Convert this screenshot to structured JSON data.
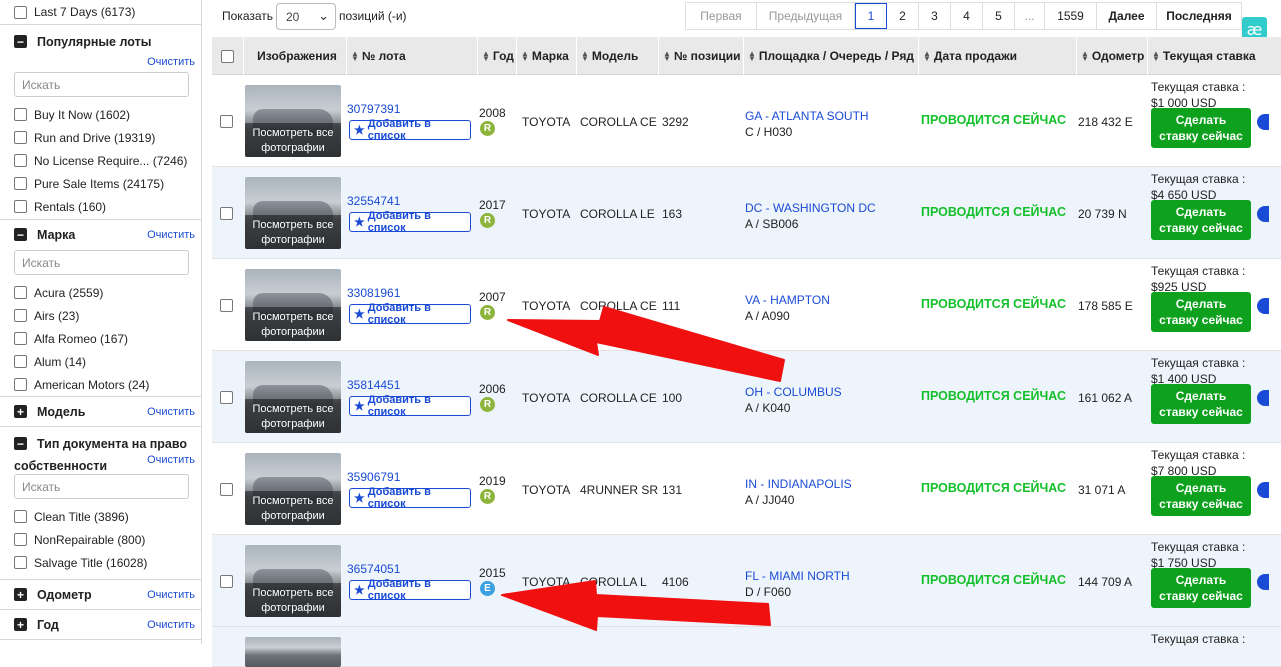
{
  "sidebar": {
    "top_item": {
      "label": "Last 7 Days (6173)"
    },
    "sections": {
      "popular": {
        "title": "Популярные лоты",
        "clear": "Очистить",
        "search_placeholder": "Искать",
        "items": [
          "Buy It Now (1602)",
          "Run and Drive (19319)",
          "No License Require... (7246)",
          "Pure Sale Items (24175)",
          "Rentals (160)"
        ]
      },
      "make": {
        "title": "Марка",
        "clear": "Очистить",
        "search_placeholder": "Искать",
        "items": [
          "Acura (2559)",
          "Airs (23)",
          "Alfa Romeo (167)",
          "Alum (14)",
          "American Motors (24)"
        ]
      },
      "model": {
        "title": "Модель",
        "clear": "Очистить"
      },
      "doc_type": {
        "title_line1": "Тип документа на право",
        "title_line2": "собственности",
        "clear": "Очистить",
        "search_placeholder": "Искать",
        "items": [
          "Clean Title (3896)",
          "NonRepairable (800)",
          "Salvage Title (16028)"
        ]
      },
      "odometer": {
        "title": "Одометр",
        "clear": "Очистить"
      },
      "year": {
        "title": "Год",
        "clear": "Очистить"
      }
    }
  },
  "toolbar": {
    "show_label": "Показать",
    "per_page": "20",
    "per_label": "позиций (-и)",
    "pager": {
      "first": "Первая",
      "prev": "Предыдущая",
      "pages": [
        "1",
        "2",
        "3",
        "4",
        "5"
      ],
      "ellipsis": "...",
      "last_page": "1559",
      "next": "Далее",
      "last": "Последняя"
    }
  },
  "table": {
    "headers": {
      "image": "Изображения",
      "lot": "№ лота",
      "year": "Год",
      "make": "Марка",
      "model": "Модель",
      "item": "№ позиции",
      "location": "Площадка / Очередь / Ряд",
      "sale_date": "Дата продажи",
      "odometer": "Одометр",
      "bid": "Текущая ставка"
    },
    "photo_label_1": "Посмотреть все",
    "photo_label_2": "фотографии",
    "watch_label": "Добавить в список",
    "live_label": "ПРОВОДИТСЯ СЕЙЧАС",
    "bid_label": "Текущая ставка :",
    "bid_button_1": "Сделать",
    "bid_button_2": "ставку сейчас",
    "rows": [
      {
        "lot": "30797391",
        "year": "2008",
        "badge": "R",
        "make": "TOYOTA",
        "model": "COROLLA CE",
        "item": "3292",
        "site": "GA - ATLANTA SOUTH",
        "lane": "C / H030",
        "odometer": "218 432 E",
        "bid": "$1 000 USD"
      },
      {
        "lot": "32554741",
        "year": "2017",
        "badge": "R",
        "make": "TOYOTA",
        "model": "COROLLA LE",
        "item": "163",
        "site": "DC - WASHINGTON DC",
        "lane": "A / SB006",
        "odometer": "20 739 N",
        "bid": "$4 650 USD"
      },
      {
        "lot": "33081961",
        "year": "2007",
        "badge": "R",
        "make": "TOYOTA",
        "model": "COROLLA CE",
        "item": "111",
        "site": "VA - HAMPTON",
        "lane": "A / A090",
        "odometer": "178 585 E",
        "bid": "$925 USD"
      },
      {
        "lot": "35814451",
        "year": "2006",
        "badge": "R",
        "make": "TOYOTA",
        "model": "COROLLA CE",
        "item": "100",
        "site": "OH - COLUMBUS",
        "lane": "A / K040",
        "odometer": "161 062 A",
        "bid": "$1 400 USD"
      },
      {
        "lot": "35906791",
        "year": "2019",
        "badge": "R",
        "make": "TOYOTA",
        "model": "4RUNNER SR",
        "item": "131",
        "site": "IN - INDIANAPOLIS",
        "lane": "A / JJ040",
        "odometer": "31 071 A",
        "bid": "$7 800 USD"
      },
      {
        "lot": "36574051",
        "year": "2015",
        "badge": "E",
        "make": "TOYOTA",
        "model": "COROLLA L",
        "item": "4106",
        "site": "FL - MIAMI NORTH",
        "lane": "D / F060",
        "odometer": "144 709 A",
        "bid": "$1 750 USD"
      }
    ],
    "partial_row_bid_label": "Текущая ставка :"
  },
  "colors": {
    "link": "#1a4bd6",
    "live": "#13c02a",
    "bid_button": "#0ea11d",
    "badge_r": "#8db53c",
    "badge_e": "#3aa0e0",
    "arrow": "#f01010"
  },
  "extension_icon": {
    "glyph": "æ"
  }
}
